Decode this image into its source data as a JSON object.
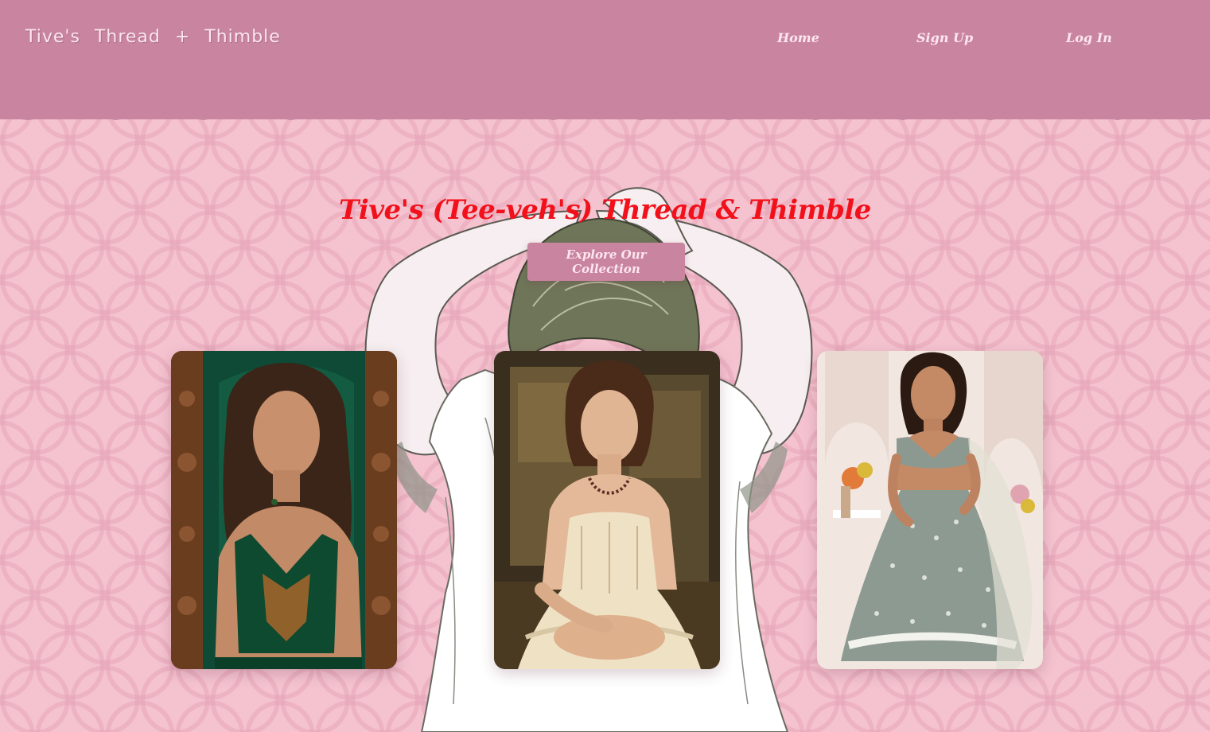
{
  "header": {
    "brand": "Tive's  Thread  +  Thimble",
    "nav": [
      {
        "label": "Home"
      },
      {
        "label": "Sign Up"
      },
      {
        "label": "Log In"
      }
    ]
  },
  "hero": {
    "title": "Tive's (Tee-veh's) Thread & Thimble",
    "cta_label": "Explore Our Collection"
  },
  "gallery": [
    {
      "subject": "woman in green embroidered crop top before carved wooden door"
    },
    {
      "subject": "woman in cream lace corset dress seated in antique room"
    },
    {
      "subject": "woman in sage embellished lehenga with sheer dupatta"
    }
  ],
  "colors": {
    "header_bg": "#c9849f",
    "page_bg": "#f5c3d0",
    "title": "#f2111a",
    "button_bg": "#c9849f",
    "nav_text": "#fde7ef"
  }
}
